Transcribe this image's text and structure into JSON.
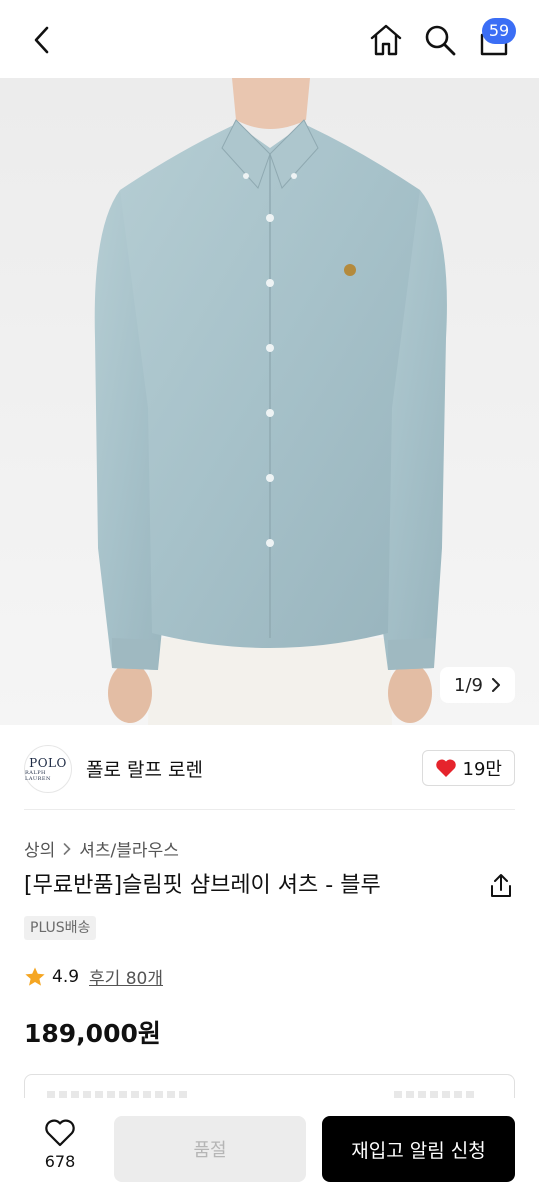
{
  "header": {
    "back_icon": "chevron-left-icon",
    "home_icon": "home-icon",
    "search_icon": "search-icon",
    "cart_icon": "shopping-bag-icon",
    "cart_count": "59",
    "badge_color": "#3b6ef5"
  },
  "gallery": {
    "counter": "1/9",
    "image_subject": "light blue chambray button-down shirt"
  },
  "brand": {
    "logo_text": "POLO",
    "logo_subtext": "RALPH LAUREN",
    "name": "폴로 랄프 로렌",
    "like_count": "19만",
    "heart_color": "#e5242c"
  },
  "product": {
    "breadcrumb": [
      "상의",
      "셔츠/블라우스"
    ],
    "title": "[무료반품]슬림핏 샴브레이 셔츠 - 블루",
    "badge": "PLUS배송",
    "rating": "4.9",
    "review_link": "후기 80개",
    "star_color": "#f5a623",
    "price": "189,000원"
  },
  "bottom_bar": {
    "wishlist_count": "678",
    "soldout_label": "품절",
    "restock_label": "재입고 알림 신청"
  }
}
